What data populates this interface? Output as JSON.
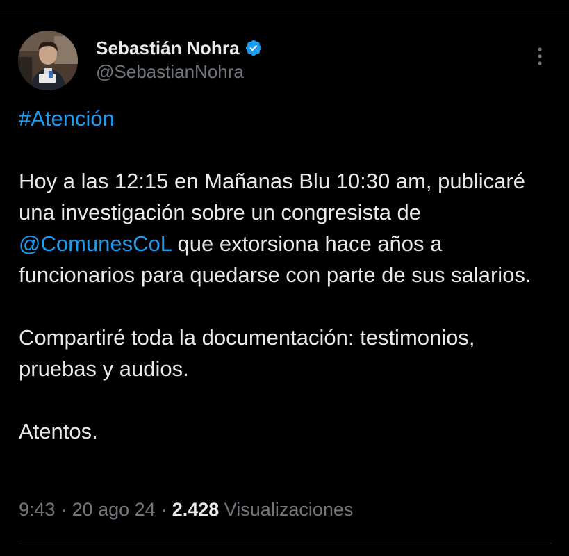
{
  "tweet": {
    "author": {
      "display_name": "Sebastián Nohra",
      "handle": "@SebastianNohra",
      "verified": true,
      "verified_badge_color": "#1d9bf0"
    },
    "content": {
      "hashtag": "#Atención",
      "paragraph1_part1": "Hoy a las 12:15 en Mañanas Blu 10:30 am, publicaré una investigación sobre un congresista de ",
      "mention": "@ComunesCoL",
      "paragraph1_part2": " que extorsiona hace años a funcionarios para quedarse con parte de sus salarios.",
      "paragraph2": "Compartiré toda la documentación: testimonios, pruebas y audios.",
      "paragraph3": "Atentos."
    },
    "meta": {
      "time": "9:43",
      "separator": " · ",
      "date": "20 ago 24",
      "views_count": "2.428",
      "views_label": " Visualizaciones"
    },
    "icons": {
      "verified": "verified-badge-icon",
      "more": "more-options-icon"
    },
    "colors": {
      "background": "#000000",
      "text": "#e7e9ea",
      "secondary_text": "#71767b",
      "link": "#1d9bf0",
      "divider": "#2f3336"
    }
  }
}
